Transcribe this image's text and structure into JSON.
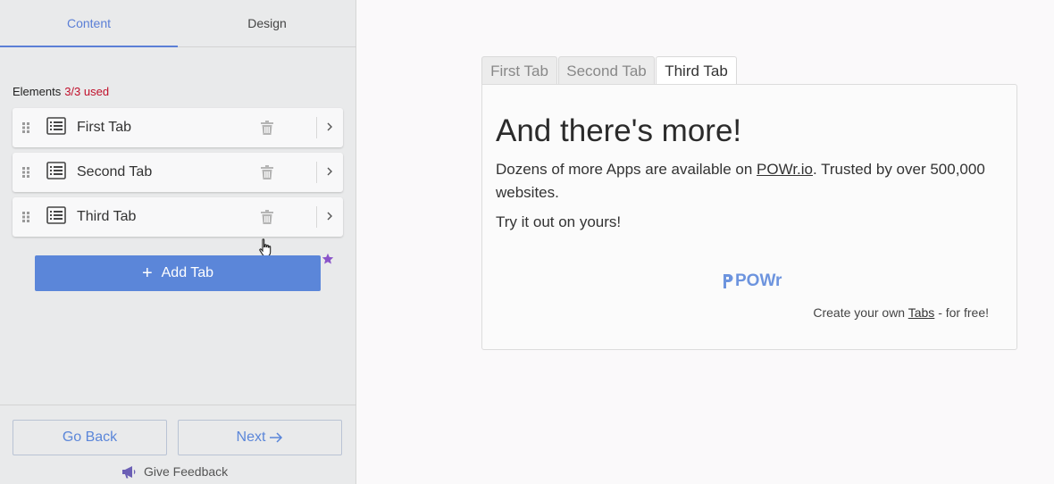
{
  "sidebar": {
    "tabs": {
      "content": "Content",
      "design": "Design"
    },
    "elements_label": "Elements",
    "elements_used": "3/3 used",
    "items": [
      {
        "label": "First Tab"
      },
      {
        "label": "Second Tab"
      },
      {
        "label": "Third Tab"
      }
    ],
    "add_label": "Add Tab",
    "back_label": "Go Back",
    "next_label": "Next",
    "feedback_label": "Give Feedback"
  },
  "preview": {
    "tabs": [
      "First Tab",
      "Second Tab",
      "Third Tab"
    ],
    "heading": "And there's more!",
    "para_before": "Dozens of more Apps are available on ",
    "para_link": "POWr.io",
    "para_after": ". Trusted by over 500,000 websites.",
    "para2": "Try it out on yours!",
    "logo_text": "POWr",
    "credit_before": "Create your own ",
    "credit_link": "Tabs",
    "credit_after": " - for free!"
  },
  "icons": {
    "drag": "drag-handle-icon",
    "list": "list-icon",
    "trash": "trash-icon",
    "chevron": "chevron-right-icon",
    "star": "star-icon",
    "megaphone": "megaphone-icon",
    "cursor": "hand-cursor-icon",
    "arrow": "arrow-right-icon"
  },
  "colors": {
    "accent": "#5b86d9",
    "used_count": "#c0102b",
    "star": "#8a54c9"
  }
}
